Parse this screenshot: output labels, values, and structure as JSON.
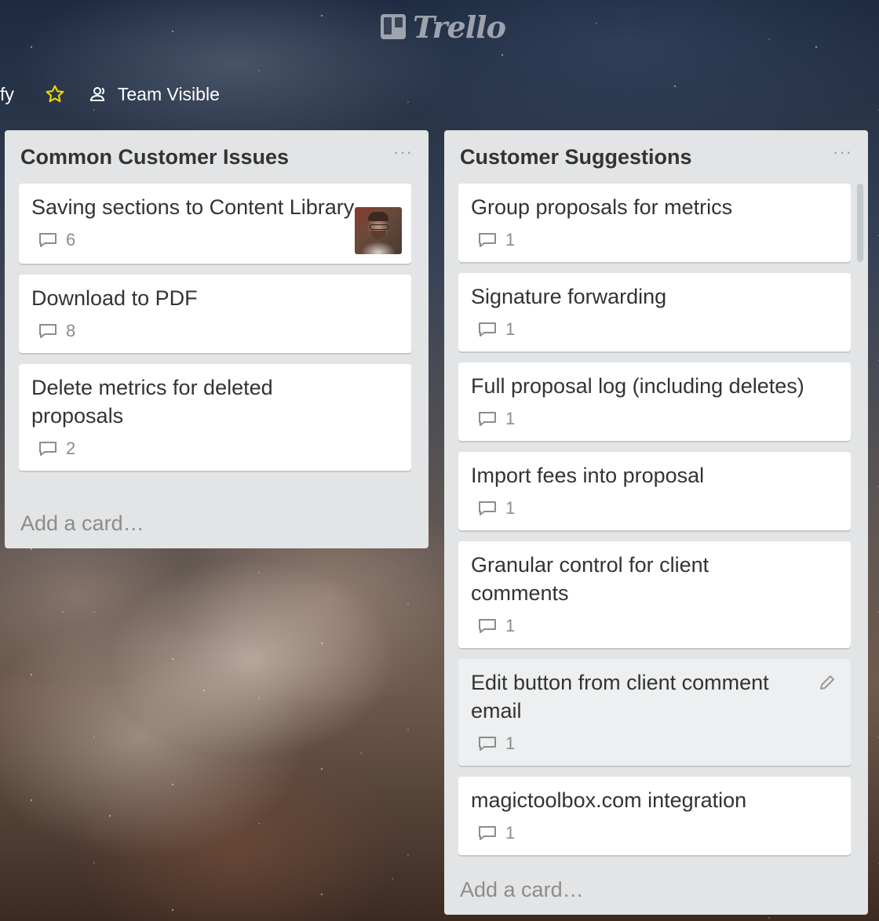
{
  "app": {
    "logo_text": "Trello"
  },
  "board_header": {
    "board_name_tail": "fy",
    "star_icon": "star-icon",
    "visibility_label": "Team Visible"
  },
  "colors": {
    "star": "#f2d600",
    "list_bg": "#e2e4e6",
    "card_bg": "#ffffff"
  },
  "lists": [
    {
      "title": "Common Customer Issues",
      "menu": "···",
      "add_card": "Add a card…",
      "cards": [
        {
          "title": "Saving sections to Content Library",
          "comments": "6",
          "has_avatar": true
        },
        {
          "title": "Download to PDF",
          "comments": "8"
        },
        {
          "title": "Delete metrics for deleted proposals",
          "comments": "2"
        }
      ]
    },
    {
      "title": "Customer Suggestions",
      "menu": "···",
      "add_card": "Add a card…",
      "cards": [
        {
          "title": "Group proposals for metrics",
          "comments": "1"
        },
        {
          "title": "Signature forwarding",
          "comments": "1"
        },
        {
          "title": "Full proposal log (including deletes)",
          "comments": "1"
        },
        {
          "title": "Import fees into proposal",
          "comments": "1"
        },
        {
          "title": "Granular control for client comments",
          "comments": "1"
        },
        {
          "title": "Edit button from client comment email",
          "comments": "1",
          "hover": true
        },
        {
          "title": "magictoolbox.com integration",
          "comments": "1"
        }
      ]
    }
  ]
}
